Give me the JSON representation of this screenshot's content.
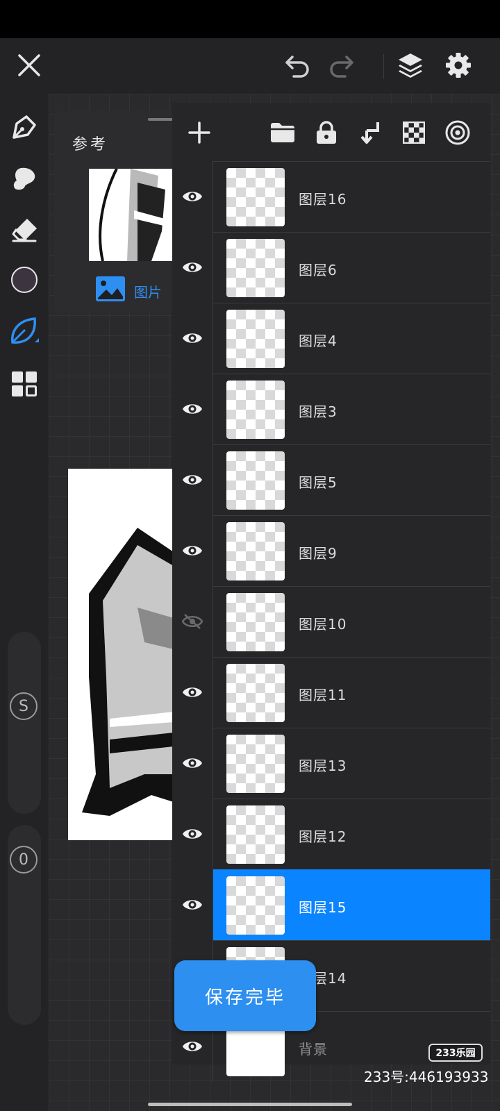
{
  "reference": {
    "title": "参考",
    "tab_label": "图片"
  },
  "sliders": {
    "size_label": "S",
    "opacity_label": "0"
  },
  "layers": [
    {
      "name": "图层16",
      "visible": true
    },
    {
      "name": "图层6",
      "visible": true
    },
    {
      "name": "图层4",
      "visible": true
    },
    {
      "name": "图层3",
      "visible": true
    },
    {
      "name": "图层5",
      "visible": true
    },
    {
      "name": "图层9",
      "visible": true
    },
    {
      "name": "图层10",
      "visible": false
    },
    {
      "name": "图层11",
      "visible": true
    },
    {
      "name": "图层13",
      "visible": true
    },
    {
      "name": "图层12",
      "visible": true
    },
    {
      "name": "图层15",
      "visible": true,
      "selected": true
    },
    {
      "name": "图层14",
      "visible": true
    },
    {
      "name": "背景",
      "visible": true
    }
  ],
  "save_button": "保存完毕",
  "watermark": {
    "badge": "233乐园",
    "id_text": "233号:446193933"
  },
  "colors": {
    "accent": "#0a84ff",
    "save": "#2d8ff0",
    "current_color": "#3c3540"
  }
}
